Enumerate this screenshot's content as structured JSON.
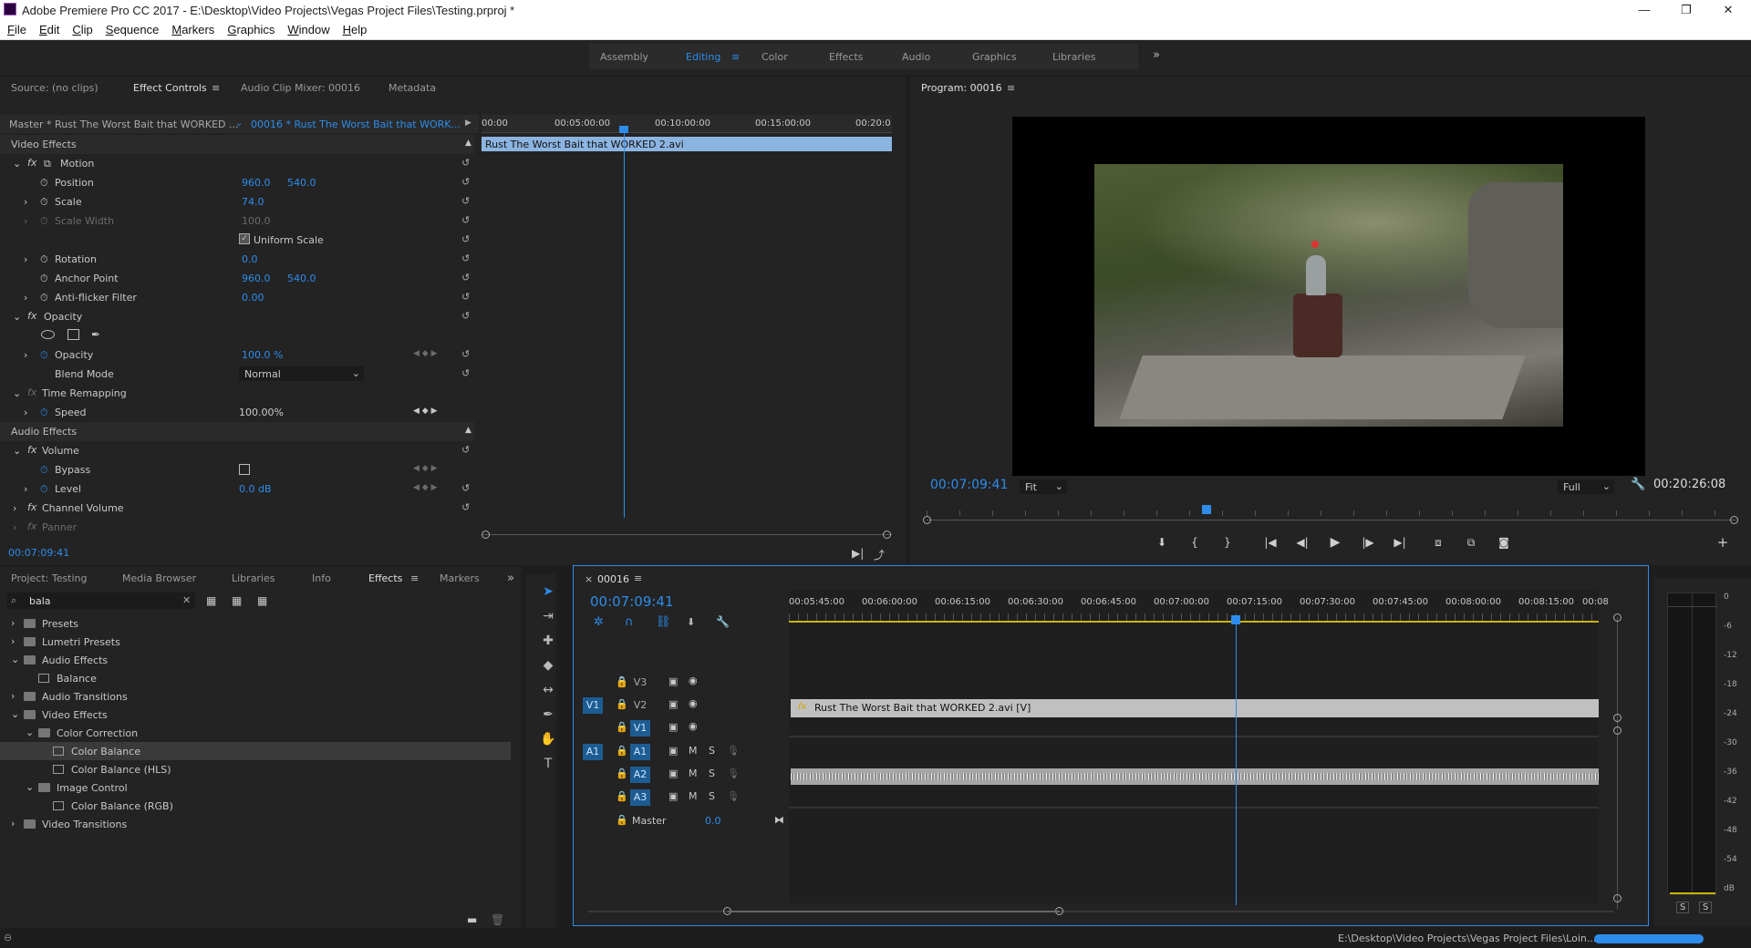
{
  "app": {
    "title": "Adobe Premiere Pro CC 2017 - E:\\Desktop\\Video Projects\\Vegas Project Files\\Testing.prproj *",
    "window_controls": {
      "minimize": "—",
      "restore": "❐",
      "close": "✕"
    }
  },
  "menu": [
    "File",
    "Edit",
    "Clip",
    "Sequence",
    "Markers",
    "Graphics",
    "Window",
    "Help"
  ],
  "workspaces": {
    "tabs": [
      "Assembly",
      "Editing",
      "Color",
      "Effects",
      "Audio",
      "Graphics",
      "Libraries"
    ],
    "active": "Editing",
    "overflow": "»"
  },
  "source_panel": {
    "tabs": [
      "Source: (no clips)",
      "Effect Controls",
      "Audio Clip Mixer: 00016",
      "Metadata"
    ],
    "active": "Effect Controls",
    "master_clip": "Master * Rust The Worst Bait that WORKED ...",
    "sequence_clip": "00016 * Rust The Worst Bait that WORK...",
    "ruler": [
      "00:00",
      "00:05:00:00",
      "00:10:00:00",
      "00:15:00:00",
      "00:20:0"
    ],
    "clip_bar": "Rust The Worst Bait that WORKED 2.avi",
    "current_time": "00:07:09:41",
    "video_effects_label": "Video Effects",
    "audio_effects_label": "Audio Effects",
    "props": {
      "motion": "Motion",
      "position": {
        "label": "Position",
        "x": "960.0",
        "y": "540.0"
      },
      "scale": {
        "label": "Scale",
        "value": "74.0"
      },
      "scale_width": {
        "label": "Scale Width",
        "value": "100.0"
      },
      "uniform_scale": "Uniform Scale",
      "rotation": {
        "label": "Rotation",
        "value": "0.0"
      },
      "anchor": {
        "label": "Anchor Point",
        "x": "960.0",
        "y": "540.0"
      },
      "antiflicker": {
        "label": "Anti-flicker Filter",
        "value": "0.00"
      },
      "opacity_group": "Opacity",
      "opacity": {
        "label": "Opacity",
        "value": "100.0 %"
      },
      "blend": {
        "label": "Blend Mode",
        "value": "Normal"
      },
      "time_remap": "Time Remapping",
      "speed": {
        "label": "Speed",
        "value": "100.00%"
      },
      "volume": "Volume",
      "bypass": "Bypass",
      "level": {
        "label": "Level",
        "value": "0.0 dB"
      },
      "channel_volume": "Channel Volume",
      "panner": "Panner"
    }
  },
  "program": {
    "title": "Program: 00016",
    "timecode": "00:07:09:41",
    "fit": "Fit",
    "quality": "Full",
    "duration": "00:20:26:08"
  },
  "project_panel": {
    "tabs": [
      "Project: Testing",
      "Media Browser",
      "Libraries",
      "Info",
      "Effects",
      "Markers"
    ],
    "active": "Effects",
    "search": "bala",
    "tree": [
      {
        "label": "Presets",
        "level": 0,
        "folder": true
      },
      {
        "label": "Lumetri Presets",
        "level": 0,
        "folder": true
      },
      {
        "label": "Audio Effects",
        "level": 0,
        "folder": true,
        "open": true
      },
      {
        "label": "Balance",
        "level": 1,
        "folder": false
      },
      {
        "label": "Audio Transitions",
        "level": 0,
        "folder": true
      },
      {
        "label": "Video Effects",
        "level": 0,
        "folder": true,
        "open": true
      },
      {
        "label": "Color Correction",
        "level": 1,
        "folder": true,
        "open": true
      },
      {
        "label": "Color Balance",
        "level": 2,
        "folder": false,
        "selected": true
      },
      {
        "label": "Color Balance (HLS)",
        "level": 2,
        "folder": false
      },
      {
        "label": "Image Control",
        "level": 1,
        "folder": true,
        "open": true
      },
      {
        "label": "Color Balance (RGB)",
        "level": 2,
        "folder": false
      },
      {
        "label": "Video Transitions",
        "level": 0,
        "folder": true
      }
    ]
  },
  "timeline": {
    "sequence": "00016",
    "timecode": "00:07:09:41",
    "ruler": [
      "00:05:45:00",
      "00:06:00:00",
      "00:06:15:00",
      "00:06:30:00",
      "00:06:45:00",
      "00:07:00:00",
      "00:07:15:00",
      "00:07:30:00",
      "00:07:45:00",
      "00:08:00:00",
      "00:08:15:00",
      "00:08"
    ],
    "video_tracks": [
      "V3",
      "V2",
      "V1"
    ],
    "audio_tracks": [
      "A1",
      "A2",
      "A3"
    ],
    "source_v": "V1",
    "source_a": "A1",
    "clip_label": "Rust The Worst Bait that WORKED 2.avi [V]",
    "master_label": "Master",
    "master_value": "0.0",
    "m": "M",
    "s": "S"
  },
  "meter": {
    "ticks": [
      "0",
      "-6",
      "-12",
      "-18",
      "-24",
      "-30",
      "-36",
      "-42",
      "-48",
      "-54",
      "dB"
    ],
    "solo": [
      "S",
      "S"
    ]
  },
  "status": {
    "path": "E:\\Desktop\\Video Projects\\Vegas Project Files\\Loin..."
  }
}
